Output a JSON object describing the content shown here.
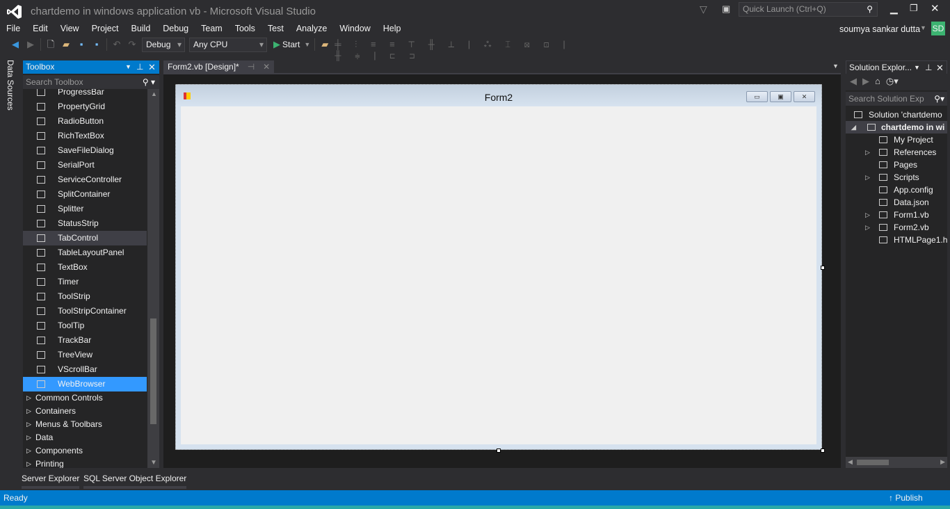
{
  "window": {
    "title": "chartdemo in windows application vb - Microsoft Visual Studio",
    "quick_launch": "Quick Launch (Ctrl+Q)",
    "user": "soumya sankar dutta",
    "avatar": "SD"
  },
  "menu": [
    "File",
    "Edit",
    "View",
    "Project",
    "Build",
    "Debug",
    "Team",
    "Tools",
    "Test",
    "Analyze",
    "Window",
    "Help"
  ],
  "toolbar": {
    "config": "Debug",
    "platform": "Any CPU",
    "start": "Start"
  },
  "side_tab": "Data Sources",
  "toolbox": {
    "title": "Toolbox",
    "search_placeholder": "Search Toolbox",
    "items": [
      "ProgressBar",
      "PropertyGrid",
      "RadioButton",
      "RichTextBox",
      "SaveFileDialog",
      "SerialPort",
      "ServiceController",
      "SplitContainer",
      "Splitter",
      "StatusStrip",
      "TabControl",
      "TableLayoutPanel",
      "TextBox",
      "Timer",
      "ToolStrip",
      "ToolStripContainer",
      "ToolTip",
      "TrackBar",
      "TreeView",
      "VScrollBar",
      "WebBrowser"
    ],
    "hover": "TabControl",
    "selected": "WebBrowser",
    "groups": [
      "Common Controls",
      "Containers",
      "Menus & Toolbars",
      "Data",
      "Components",
      "Printing"
    ]
  },
  "document": {
    "tab": "Form2.vb [Design]*",
    "form_title": "Form2"
  },
  "solution": {
    "title": "Solution Explor...",
    "search_placeholder": "Search Solution Exp",
    "items": [
      {
        "label": "Solution 'chartdemo",
        "indent": 0,
        "exp": ""
      },
      {
        "label": "chartdemo in wi",
        "indent": 1,
        "exp": "◢",
        "bold": true
      },
      {
        "label": "My Project",
        "indent": 2,
        "exp": ""
      },
      {
        "label": "References",
        "indent": 2,
        "exp": "▷"
      },
      {
        "label": "Pages",
        "indent": 2,
        "exp": ""
      },
      {
        "label": "Scripts",
        "indent": 2,
        "exp": "▷"
      },
      {
        "label": "App.config",
        "indent": 2,
        "exp": ""
      },
      {
        "label": "Data.json",
        "indent": 2,
        "exp": ""
      },
      {
        "label": "Form1.vb",
        "indent": 2,
        "exp": "▷"
      },
      {
        "label": "Form2.vb",
        "indent": 2,
        "exp": "▷"
      },
      {
        "label": "HTMLPage1.h",
        "indent": 2,
        "exp": ""
      }
    ]
  },
  "bottom_tabs": [
    "Server Explorer",
    "SQL Server Object Explorer"
  ],
  "status": {
    "text": "Ready",
    "publish": "Publish"
  },
  "colors": {
    "accent": "#007acc",
    "bg": "#2d2d30",
    "panel": "#252526"
  }
}
